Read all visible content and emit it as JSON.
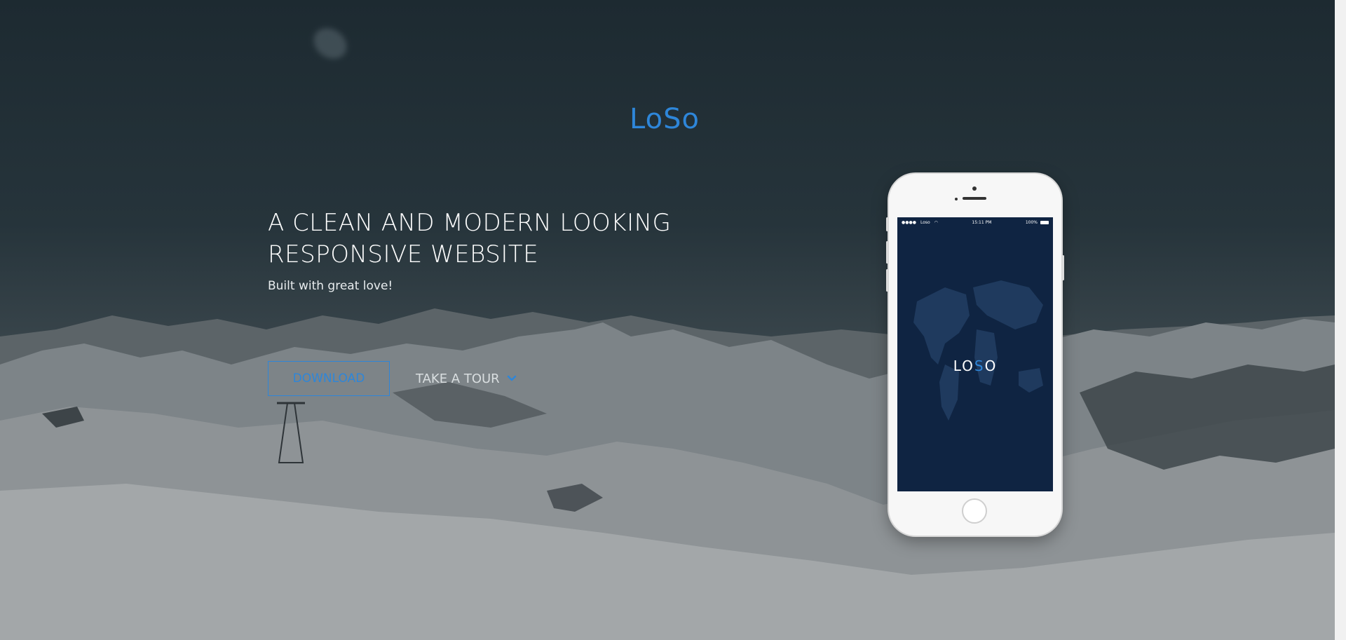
{
  "brand": {
    "logo_text": "LoSo",
    "accent_color": "#2e86d9"
  },
  "hero": {
    "headline_line1": "A CLEAN AND MODERN LOOKING",
    "headline_line2": "RESPONSIVE WEBSITE",
    "subheadline": "Built with great love!",
    "download_label": "DOWNLOAD",
    "tour_label": "TAKE A TOUR",
    "tour_icon": "chevron-down-icon"
  },
  "phone": {
    "status_carrier": "Loso",
    "status_time": "15:11 PM",
    "status_battery": "100%",
    "screen_logo_left": "LO",
    "screen_logo_accent": "S",
    "screen_logo_right": "O",
    "screen_color": "#0f2442"
  }
}
